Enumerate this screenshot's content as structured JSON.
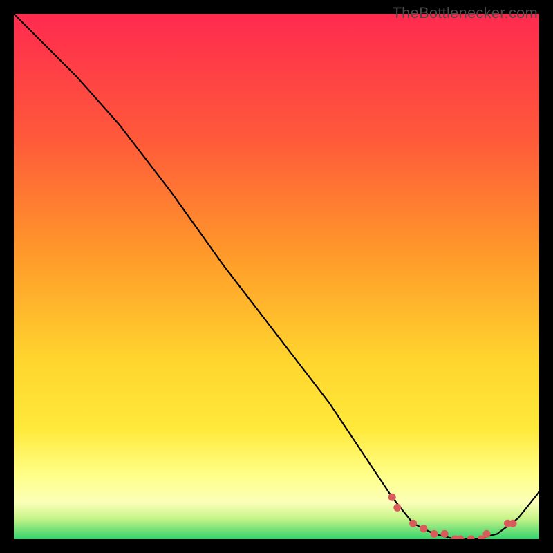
{
  "watermark": "TheBottlenecker.com",
  "colors": {
    "red": "#ff2a4f",
    "orange": "#ff9a2a",
    "yellow": "#ffe93a",
    "paleyellow": "#ffffa8",
    "green": "#35d46e",
    "curve": "#000000",
    "marker": "#d85a5a"
  },
  "chart_data": {
    "type": "line",
    "title": "",
    "xlabel": "",
    "ylabel": "",
    "xlim": [
      0,
      100
    ],
    "ylim": [
      0,
      100
    ],
    "series": [
      {
        "name": "bottleneck-curve",
        "x": [
          0,
          6,
          12,
          20,
          30,
          40,
          50,
          60,
          68,
          72,
          76,
          80,
          84,
          88,
          92,
          96,
          100
        ],
        "y": [
          100,
          94,
          88,
          79,
          66,
          52,
          39,
          26,
          14,
          8,
          3,
          1,
          0,
          0,
          1,
          4,
          9
        ]
      }
    ],
    "annotations": [
      {
        "type": "marker",
        "x": 72,
        "y": 8
      },
      {
        "type": "marker",
        "x": 73,
        "y": 6
      },
      {
        "type": "marker",
        "x": 76,
        "y": 3
      },
      {
        "type": "marker",
        "x": 78,
        "y": 2
      },
      {
        "type": "marker",
        "x": 80,
        "y": 1
      },
      {
        "type": "marker",
        "x": 82,
        "y": 1
      },
      {
        "type": "marker",
        "x": 84,
        "y": 0
      },
      {
        "type": "marker",
        "x": 85,
        "y": 0
      },
      {
        "type": "marker",
        "x": 87,
        "y": 0
      },
      {
        "type": "marker",
        "x": 89,
        "y": 0
      },
      {
        "type": "marker",
        "x": 90,
        "y": 1
      },
      {
        "type": "marker",
        "x": 94,
        "y": 3
      },
      {
        "type": "marker",
        "x": 95,
        "y": 3
      }
    ]
  }
}
